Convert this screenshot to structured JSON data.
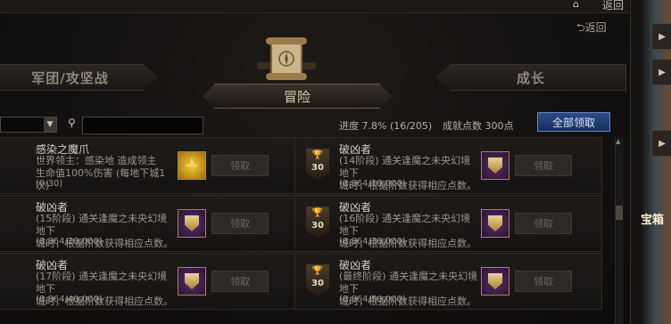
{
  "topbar": {
    "home_icon": "home-icon",
    "back": "返回"
  },
  "header": {
    "back": "返回",
    "tabs": {
      "left": "军团/攻坚战",
      "center": "冒险",
      "right": "成长"
    }
  },
  "filter": {
    "search_placeholder": "",
    "progress": "进度  7.8% (16/205)",
    "points": "成就点数 300点",
    "claim_all": "全部领取"
  },
  "cards": [
    {
      "title": "感染之魔爪",
      "desc": "世界领主：感染地      造成领主\n生命值100%伤害 (每地下城1次)",
      "progress": "(0/30)",
      "claim": "领取",
      "reward": "gold",
      "badge": ""
    },
    {
      "title": "破凶者",
      "desc": "(14阶段) 通关逢魔之未央幻境地下\n城时，根据阶数获得相应点数。",
      "progress": "(8,864/10,000)",
      "claim": "领取",
      "reward": "shield",
      "badge": "30"
    },
    {
      "title": "破凶者",
      "desc": "(15阶段) 通关逢魔之未央幻境地下\n城时，根据阶数获得相应点数。",
      "progress": "(8,864/20,000)",
      "claim": "领取",
      "reward": "shield",
      "badge": ""
    },
    {
      "title": "破凶者",
      "desc": "(16阶段) 通关逢魔之未央幻境地下\n城时，根据阶数获得相应点数。",
      "progress": "(8,864/30,000)",
      "claim": "领取",
      "reward": "shield",
      "badge": "30"
    },
    {
      "title": "破凶者",
      "desc": "(17阶段) 通关逢魔之未央幻境地下\n城时，根据阶数获得相应点数。",
      "progress": "(8,864/40,000)",
      "claim": "领取",
      "reward": "shield",
      "badge": ""
    },
    {
      "title": "破凶者",
      "desc": "(最终阶段) 通关逢魔之未央幻境地下\n城时，根据阶数获得相应点数。",
      "progress": "(8,864/50,000)",
      "claim": "领取",
      "reward": "shield",
      "badge": "30"
    }
  ],
  "right_panel": {
    "label": "宝箱"
  },
  "colors": {
    "accent_blue": "#234580",
    "gold": "#a98a45"
  }
}
